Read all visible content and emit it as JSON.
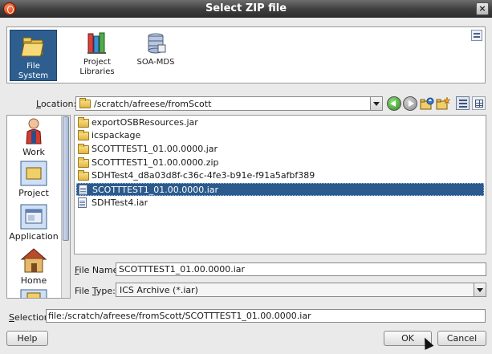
{
  "window": {
    "title": "Select ZIP file"
  },
  "places": [
    {
      "label_line1": "File",
      "label_line2": "System",
      "icon": "file-system-icon",
      "selected": true
    },
    {
      "label_line1": "Project",
      "label_line2": "Libraries",
      "icon": "project-libraries-icon",
      "selected": false
    },
    {
      "label_line1": "SOA-MDS",
      "label_line2": "",
      "icon": "soa-mds-icon",
      "selected": false
    }
  ],
  "location": {
    "label_pre": "",
    "label_mnemonic": "L",
    "label_post": "ocation:",
    "value": "/scratch/afreese/fromScott"
  },
  "sidebar": {
    "items": [
      {
        "label": "Work",
        "icon": "work-person-icon"
      },
      {
        "label": "Project",
        "icon": "project-icon"
      },
      {
        "label": "Application",
        "icon": "application-icon"
      },
      {
        "label": "Home",
        "icon": "home-icon"
      }
    ]
  },
  "files": [
    {
      "name": "exportOSBResources.jar",
      "type": "folder",
      "selected": false
    },
    {
      "name": "icspackage",
      "type": "folder",
      "selected": false
    },
    {
      "name": "SCOTTTEST1_01.00.0000.jar",
      "type": "folder",
      "selected": false
    },
    {
      "name": "SCOTTTEST1_01.00.0000.zip",
      "type": "folder",
      "selected": false
    },
    {
      "name": "SDHTest4_d8a03d8f-c36c-4fe3-b91e-f91a5afbf389",
      "type": "folder",
      "selected": false
    },
    {
      "name": "SCOTTTEST1_01.00.0000.iar",
      "type": "file",
      "selected": true
    },
    {
      "name": "SDHTest4.iar",
      "type": "file",
      "selected": false
    }
  ],
  "file_name": {
    "label_mnemonic": "F",
    "label_post": "ile Name:",
    "value": "SCOTTTEST1_01.00.0000.iar"
  },
  "file_type": {
    "label_pre": "File ",
    "label_mnemonic": "T",
    "label_post": "ype:",
    "value": "ICS Archive (*.iar)"
  },
  "selection": {
    "label_mnemonic": "S",
    "label_post": "election:",
    "value": "file:/scratch/afreese/fromScott/SCOTTTEST1_01.00.0000.iar"
  },
  "buttons": {
    "help": "Help",
    "ok": "OK",
    "cancel": "Cancel"
  },
  "colors": {
    "selection_bg": "#2b5a8c",
    "titlebar": "#3f3f3f",
    "place_selected": "#2d5e8f"
  }
}
